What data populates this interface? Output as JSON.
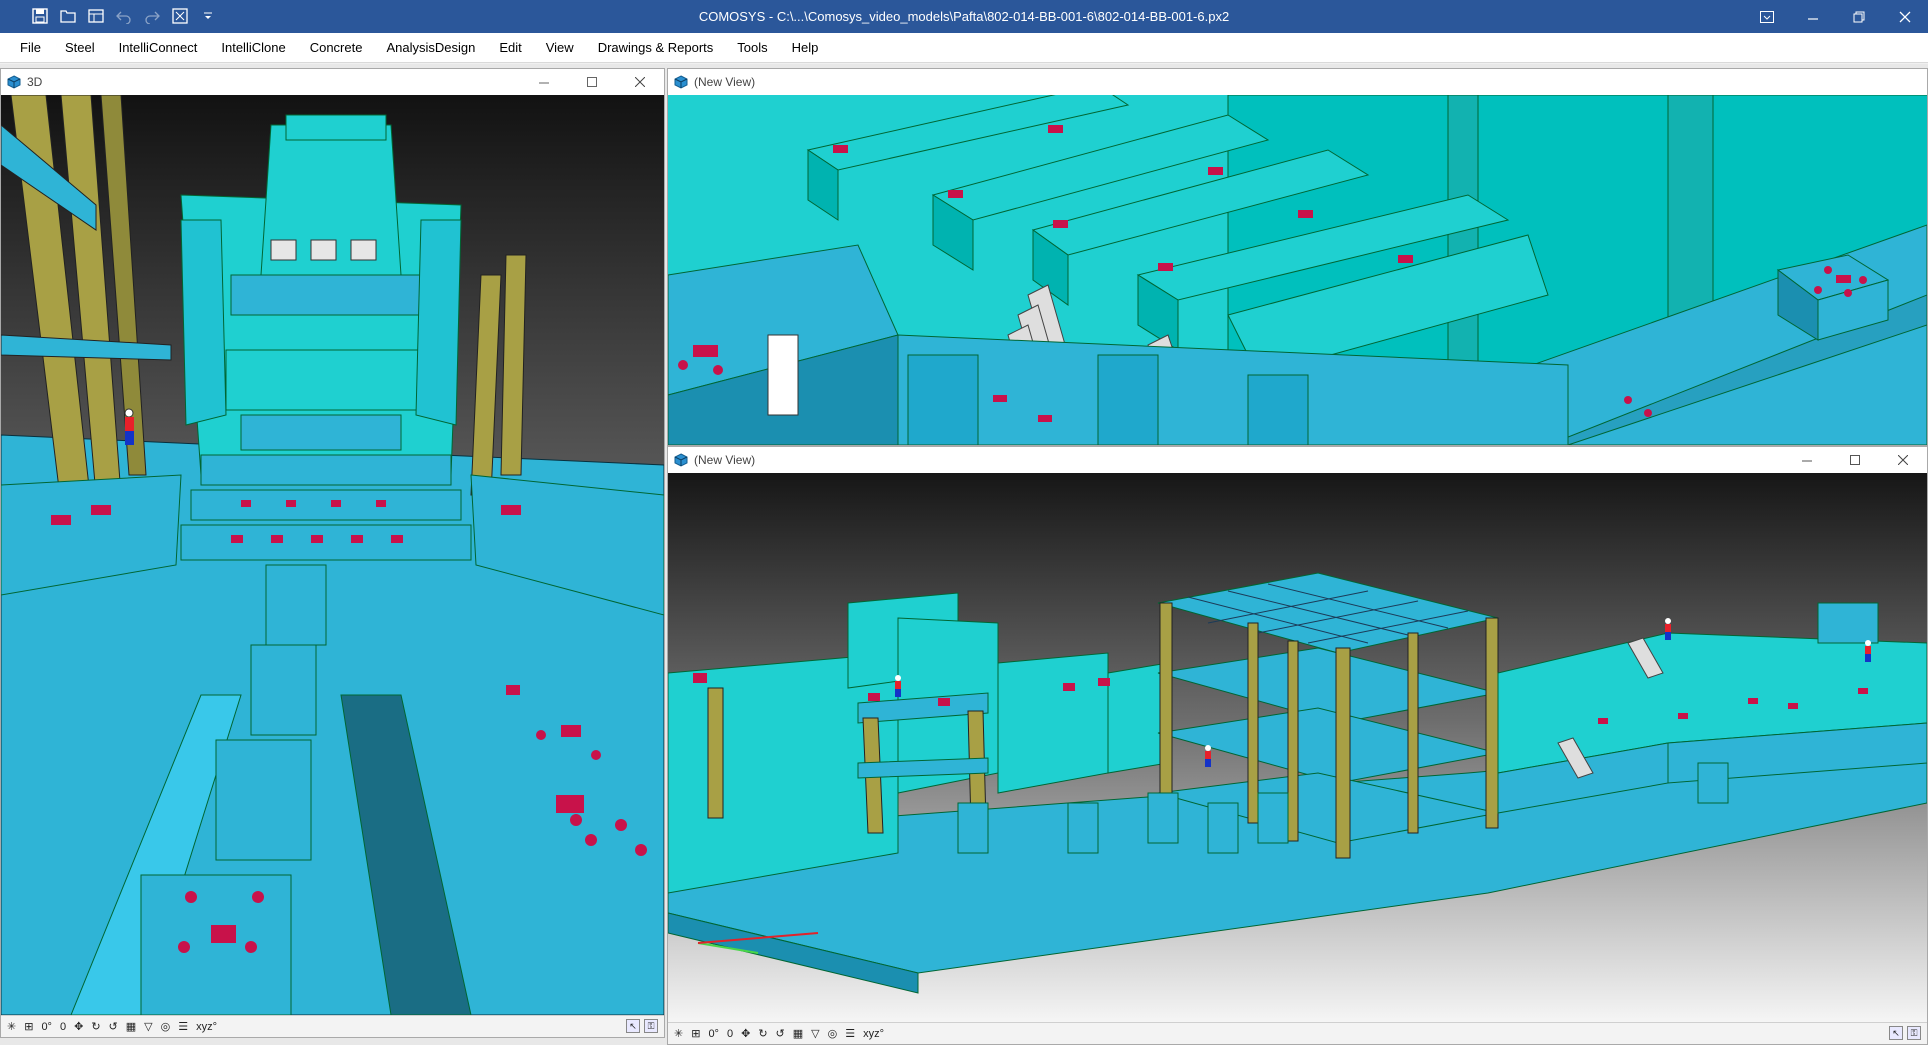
{
  "window": {
    "title": "COMOSYS - C:\\...\\Comosys_video_models\\Pafta\\802-014-BB-001-6\\802-014-BB-001-6.px2",
    "qat_icons": [
      "save-icon",
      "open-folder-icon",
      "save-all-icon",
      "undo-icon",
      "redo-icon",
      "fit-view-icon",
      "customize-dropdown-icon"
    ],
    "controls": [
      "ribbon-display-icon",
      "minimize-icon",
      "restore-icon",
      "close-icon"
    ]
  },
  "menu": {
    "items": [
      "File",
      "Steel",
      "IntelliConnect",
      "IntelliClone",
      "Concrete",
      "AnalysisDesign",
      "Edit",
      "View",
      "Drawings & Reports",
      "Tools",
      "Help"
    ]
  },
  "views": {
    "left": {
      "title": "3D",
      "status": {
        "angle1": "0°",
        "angle2": "0",
        "coords": "xyz°"
      }
    },
    "top_right": {
      "title": "(New View)"
    },
    "bottom_right": {
      "title": "(New View)",
      "status": {
        "angle1": "0°",
        "angle2": "0",
        "coords": "xyz°"
      }
    }
  },
  "colors": {
    "titlebar": "#2b579a",
    "concrete": "#2fb4d6",
    "concrete_light": "#1fd0d0",
    "steel": "#a8a045",
    "rebar_marks": "#c8124a",
    "background_top": "#1a1a1a",
    "background_bottom": "#f5f5f5"
  }
}
